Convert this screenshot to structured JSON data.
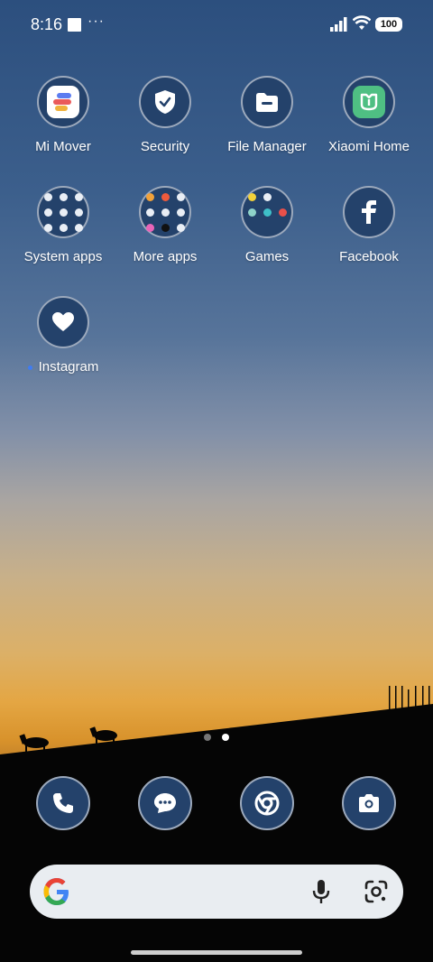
{
  "status": {
    "time": "8:16",
    "overflow": "···",
    "battery": "100",
    "icons": [
      "signal-icon",
      "wifi-icon",
      "battery-icon"
    ]
  },
  "apps": [
    {
      "label": "Mi Mover",
      "icon": "mi-mover-icon"
    },
    {
      "label": "Security",
      "icon": "shield-check-icon"
    },
    {
      "label": "File Manager",
      "icon": "folder-icon"
    },
    {
      "label": "Xiaomi Home",
      "icon": "xiaomi-home-icon"
    },
    {
      "label": "System apps",
      "icon": "folder-grid-icon"
    },
    {
      "label": "More apps",
      "icon": "folder-grid-icon"
    },
    {
      "label": "Games",
      "icon": "folder-grid-icon"
    },
    {
      "label": "Facebook",
      "icon": "facebook-icon"
    },
    {
      "label": "Instagram",
      "icon": "heart-icon"
    }
  ],
  "page_indicator": {
    "count": 2,
    "active": 2
  },
  "dock": [
    {
      "icon": "phone-icon"
    },
    {
      "icon": "messages-icon"
    },
    {
      "icon": "chrome-icon"
    },
    {
      "icon": "camera-icon"
    }
  ],
  "search": {
    "icons": [
      "google-logo-icon",
      "mic-icon",
      "lens-icon"
    ]
  },
  "colors": {
    "icon_bg": "#24426b",
    "accent_dot": "#3f7cf3",
    "search_bg": "#e9edf1"
  }
}
